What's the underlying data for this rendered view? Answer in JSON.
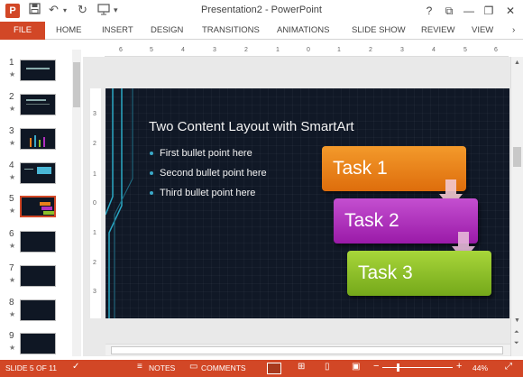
{
  "window": {
    "title": "Presentation2 - PowerPoint",
    "controls": [
      "?",
      "⧉",
      "—",
      "❐",
      "✕"
    ]
  },
  "ribbon": {
    "tabs": [
      "FILE",
      "HOME",
      "INSERT",
      "DESIGN",
      "TRANSITIONS",
      "ANIMATIONS",
      "SLIDE SHOW",
      "REVIEW",
      "VIEW"
    ]
  },
  "ruler": {
    "h_ticks": [
      "6",
      "5",
      "4",
      "3",
      "2",
      "1",
      "0",
      "1",
      "2",
      "3",
      "4",
      "5",
      "6"
    ],
    "v_ticks": [
      "3",
      "2",
      "1",
      "0",
      "1",
      "2",
      "3"
    ]
  },
  "thumbnails": [
    {
      "num": "1",
      "star": "★"
    },
    {
      "num": "2",
      "star": "★"
    },
    {
      "num": "3",
      "star": "★"
    },
    {
      "num": "4",
      "star": "★"
    },
    {
      "num": "5",
      "star": "★",
      "selected": true
    },
    {
      "num": "6",
      "star": "★"
    },
    {
      "num": "7",
      "star": "★"
    },
    {
      "num": "8",
      "star": "★"
    },
    {
      "num": "9",
      "star": "★"
    }
  ],
  "slide": {
    "title": "Two Content Layout with SmartArt",
    "bullets": [
      "First bullet point here",
      "Second bullet point here",
      "Third bullet point here"
    ],
    "tasks": [
      "Task 1",
      "Task 2",
      "Task 3"
    ]
  },
  "status": {
    "slide_info": "SLIDE 5 OF 11",
    "notes": "NOTES",
    "comments": "COMMENTS",
    "zoom": "44%"
  },
  "colors": {
    "accent": "#d24726",
    "slide_bg": "#101826",
    "task1": "#e9801a",
    "task2": "#b030bf",
    "task3": "#8cc02a"
  }
}
